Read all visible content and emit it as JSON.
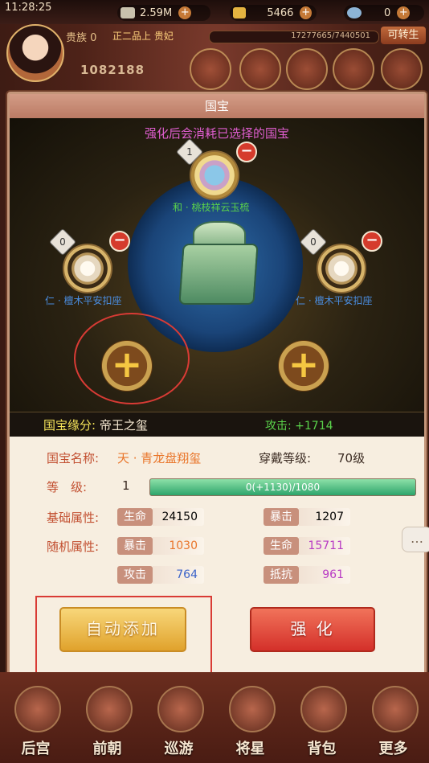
{
  "status": {
    "time": "11:28:25"
  },
  "resources": [
    {
      "value": "2.59M",
      "icon": "coin-icon",
      "color": "#c9c2ad"
    },
    {
      "value": "5466",
      "icon": "gold-ingot-icon",
      "color": "#e4b340"
    },
    {
      "value": "0",
      "icon": "gift-icon",
      "color": "#8db4d6"
    }
  ],
  "player": {
    "rank": "贵族 0",
    "title": "正二品上 贵妃",
    "exp": "17277665/7440501",
    "promote_label": "可转生",
    "power": "1082188"
  },
  "dialog": {
    "title": "国宝",
    "notice": "强化后会消耗已选择的国宝",
    "slots": {
      "top": {
        "count": "1",
        "name": "和 · 桃枝祥云玉梳"
      },
      "left": {
        "count": "0",
        "name": "仁 · 檀木平安扣座"
      },
      "right": {
        "count": "0",
        "name": "仁 · 檀木平安扣座"
      }
    },
    "fate_label": "国宝缘分:",
    "fate_value": "帝王之玺",
    "attack_bonus": "攻击: +1714"
  },
  "info": {
    "name_label": "国宝名称:",
    "name_value": "天 · 青龙盘翔玺",
    "wear_label": "穿戴等级:",
    "wear_value": "70级",
    "level_label": "等　级:",
    "level_value": "1",
    "progress_text": "0(+1130)/1080",
    "progress_fraction": 1.0,
    "base_label": "基础属性:",
    "random_label": "随机属性:",
    "base_stats": [
      {
        "key": "生命",
        "value": "24150",
        "color": "#3b2b22"
      },
      {
        "key": "暴击",
        "value": "1207",
        "color": "#3b2b22"
      }
    ],
    "random_stats": [
      {
        "key": "暴击",
        "value": "1030",
        "color": "#e9762b"
      },
      {
        "key": "生命",
        "value": "15711",
        "color": "#b83ac4"
      },
      {
        "key": "攻击",
        "value": "764",
        "color": "#3b63c9"
      },
      {
        "key": "抵抗",
        "value": "961",
        "color": "#b83ac4"
      }
    ],
    "auto_add_label": "自动添加",
    "strengthen_label": "强 化"
  },
  "nav": [
    {
      "label": "后宫",
      "icon": "palace-icon"
    },
    {
      "label": "前朝",
      "icon": "court-icon"
    },
    {
      "label": "巡游",
      "icon": "tour-icon"
    },
    {
      "label": "将星",
      "icon": "general-icon"
    },
    {
      "label": "背包",
      "icon": "bag-icon"
    },
    {
      "label": "更多",
      "icon": "more-icon"
    }
  ]
}
